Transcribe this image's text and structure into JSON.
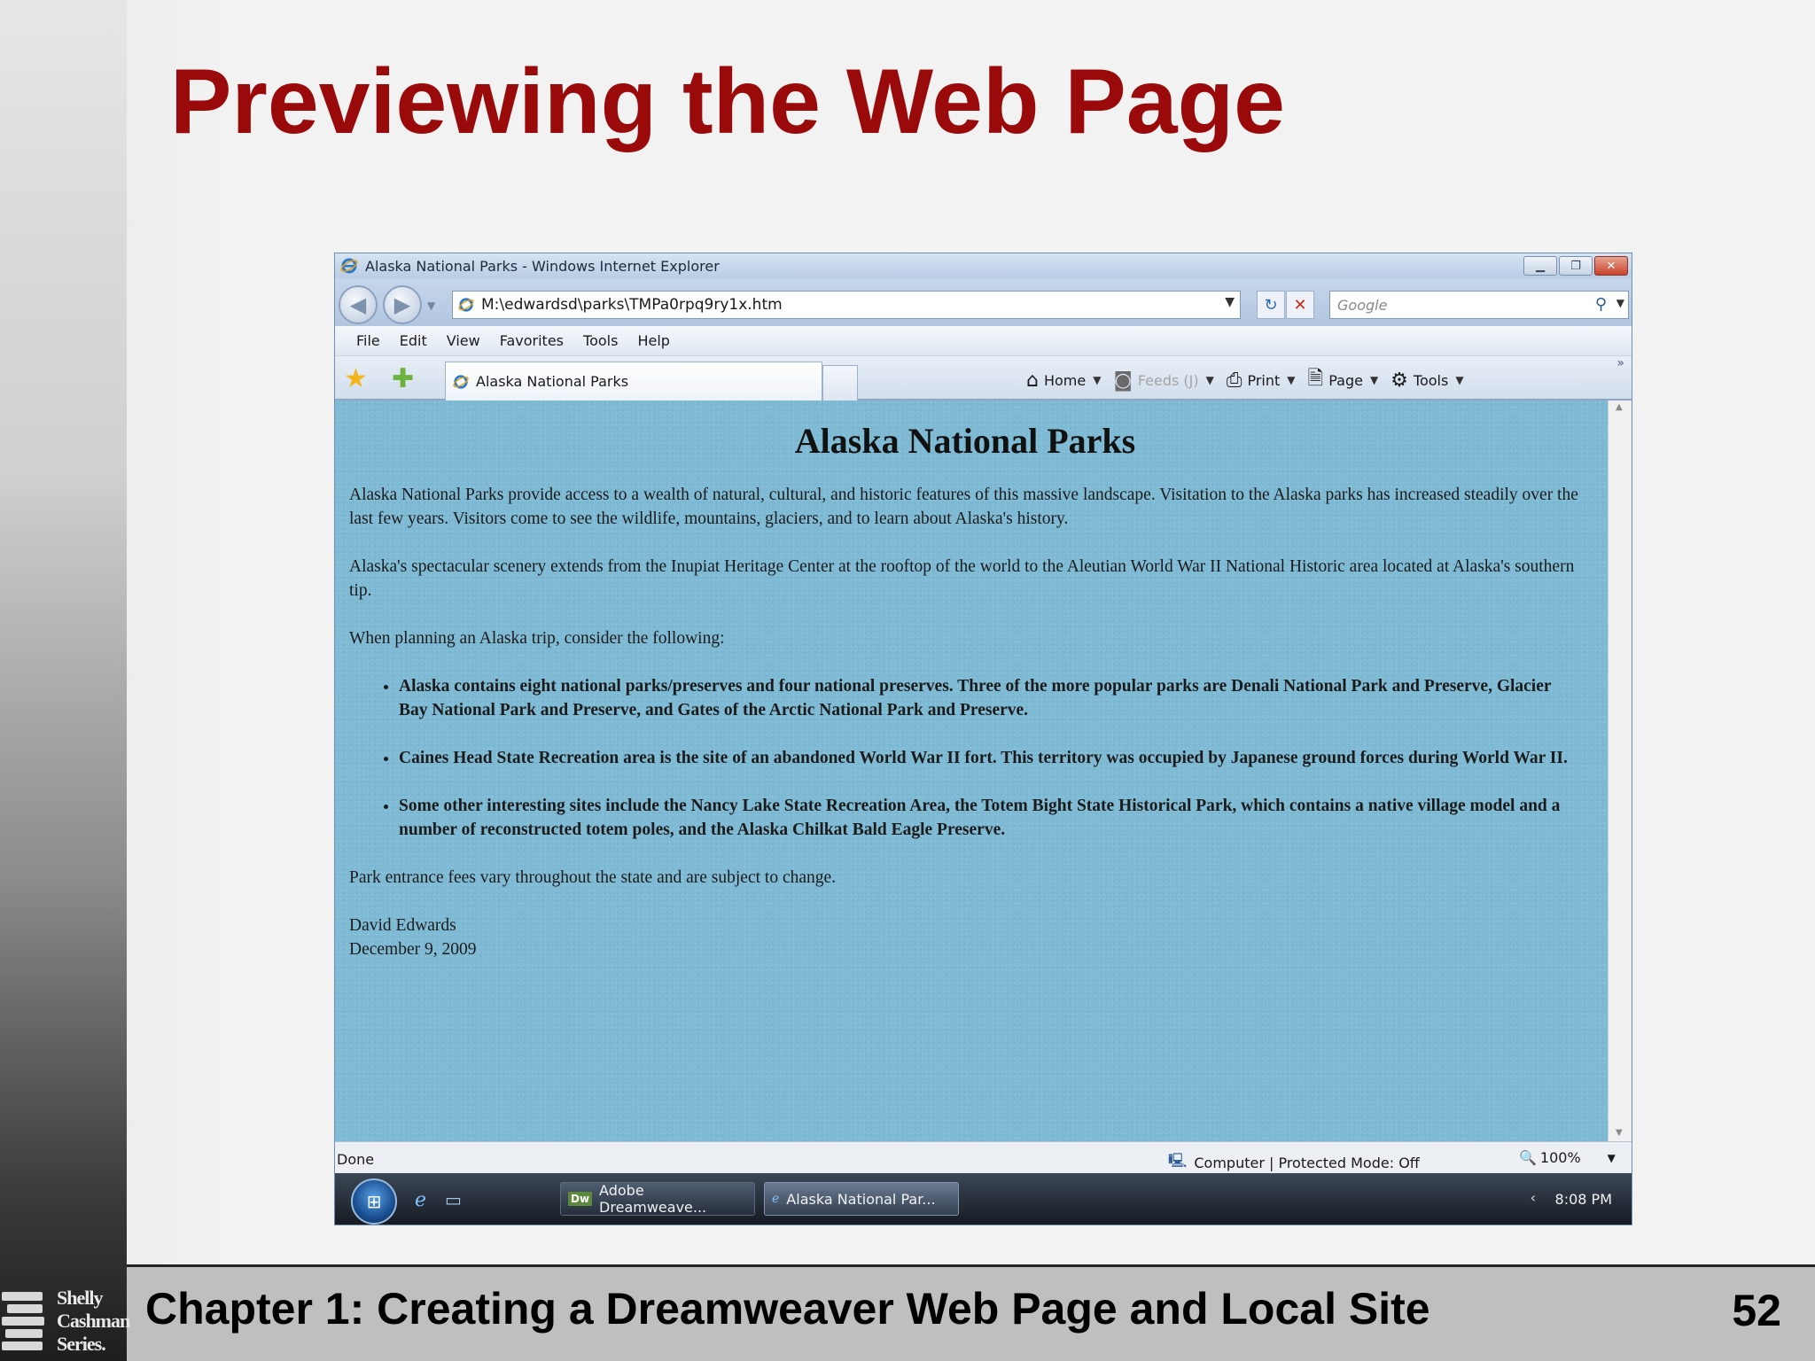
{
  "slide": {
    "title": "Previewing the Web Page",
    "footer": "Chapter 1: Creating a Dreamweaver Web Page and Local Site",
    "page_number": "52",
    "logo_lines": [
      "Shelly",
      "Cashman",
      "Series."
    ]
  },
  "browser": {
    "window_title": "Alaska National Parks - Windows Internet Explorer",
    "address": "M:\\edwardsd\\parks\\TMPa0rpq9ry1x.htm",
    "search_placeholder": "Google",
    "menu": [
      "File",
      "Edit",
      "View",
      "Favorites",
      "Tools",
      "Help"
    ],
    "tab_label": "Alaska National Parks",
    "commands": {
      "home": "Home",
      "feeds": "Feeds (J)",
      "print": "Print",
      "page": "Page",
      "tools": "Tools"
    },
    "status": {
      "left": "Done",
      "zone": "Computer | Protected Mode: Off",
      "zoom": "100%"
    },
    "taskbar": {
      "items": [
        "Adobe Dreamweave...",
        "Alaska National Par..."
      ],
      "clock": "8:08 PM"
    }
  },
  "page": {
    "heading": "Alaska National Parks",
    "paragraphs": [
      "Alaska National Parks provide access to a wealth of natural, cultural, and historic features of this massive landscape. Visitation to the Alaska parks has increased steadily over the last few years. Visitors come to see the wildlife, mountains, glaciers, and to learn about Alaska's history.",
      "Alaska's spectacular scenery extends from the Inupiat Heritage Center at the rooftop of the world to the Aleutian World War II National Historic area located at Alaska's southern tip.",
      "When planning an Alaska trip, consider the following:"
    ],
    "bullets": [
      "Alaska contains eight national parks/preserves and four national preserves. Three of the more popular parks are Denali National Park and Preserve, Glacier Bay National Park and Preserve, and Gates of the Arctic National Park and Preserve.",
      "Caines Head State Recreation area is the site of an abandoned World War II fort. This territory was occupied by Japanese ground forces during World War II.",
      "Some other interesting sites include the Nancy Lake State Recreation Area, the Totem Bight State Historical Park, which contains a native village model and a number of reconstructed totem poles, and the Alaska Chilkat Bald Eagle Preserve."
    ],
    "closing": "Park entrance fees vary throughout the state and are subject to change.",
    "author": "David Edwards",
    "date": "December 9, 2009"
  }
}
